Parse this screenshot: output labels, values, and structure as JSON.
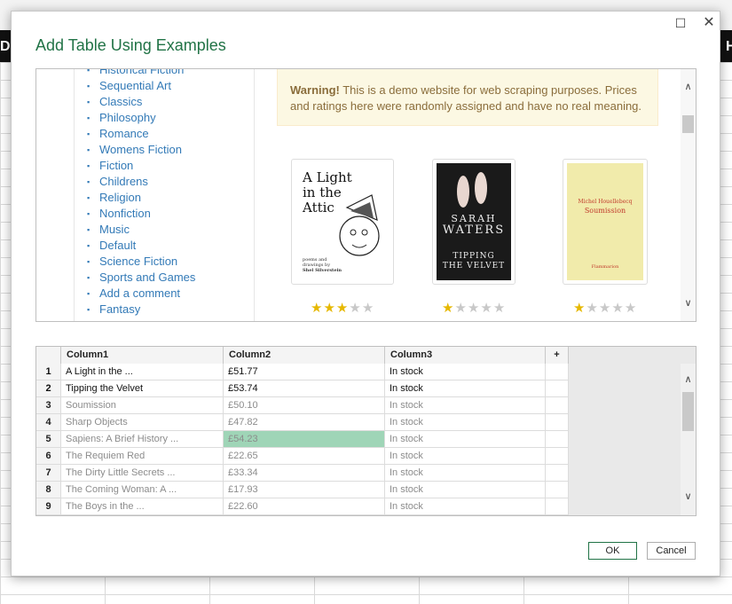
{
  "background": {
    "left_char": "D",
    "right_char": "H"
  },
  "dialog": {
    "title": "Add Table Using Examples",
    "maximize_glyph": "☐",
    "close_glyph": "✕",
    "ok_label": "OK",
    "cancel_label": "Cancel"
  },
  "preview": {
    "categories": [
      "Historical Fiction",
      "Sequential Art",
      "Classics",
      "Philosophy",
      "Romance",
      "Womens Fiction",
      "Fiction",
      "Childrens",
      "Religion",
      "Nonfiction",
      "Music",
      "Default",
      "Science Fiction",
      "Sports and Games",
      "Add a comment",
      "Fantasy"
    ],
    "warning": {
      "bold": "Warning!",
      "text": " This is a demo website for web scraping purposes. Prices and ratings here were randomly assigned and have no real meaning."
    },
    "books": [
      {
        "cover_title_lines": [
          "A Light",
          "in the",
          "Attic"
        ],
        "cover_credit_1": "poems and",
        "cover_credit_2": "drawings by",
        "cover_author": "Shel Silverstein",
        "rating": 3
      },
      {
        "cover_author": "SARAH",
        "cover_author_2": "WATERS",
        "cover_title_1": "TIPPING",
        "cover_title_2": "THE VELVET",
        "rating": 1
      },
      {
        "cover_author": "Michel Houellebecq",
        "cover_title": "Soumission",
        "cover_publisher": "Flammarion",
        "rating": 1
      }
    ],
    "star_glyph": "★",
    "scroll_up": "∧",
    "scroll_down": "∨"
  },
  "table": {
    "columns": [
      "Column1",
      "Column2",
      "Column3"
    ],
    "add_column": "+",
    "rows": [
      {
        "num": "1",
        "c1": "A Light in the ...",
        "c2": "£51.77",
        "c3": "In stock",
        "kind": "typed"
      },
      {
        "num": "2",
        "c1": "Tipping the Velvet",
        "c2": "£53.74",
        "c3": "In stock",
        "kind": "typed"
      },
      {
        "num": "3",
        "c1": "Soumission",
        "c2": "£50.10",
        "c3": "In stock",
        "kind": "suggested"
      },
      {
        "num": "4",
        "c1": "Sharp Objects",
        "c2": "£47.82",
        "c3": "In stock",
        "kind": "suggested"
      },
      {
        "num": "5",
        "c1": "Sapiens: A Brief History ...",
        "c2": "£54.23",
        "c3": "In stock",
        "kind": "suggested"
      },
      {
        "num": "6",
        "c1": "The Requiem Red",
        "c2": "£22.65",
        "c3": "In stock",
        "kind": "suggested"
      },
      {
        "num": "7",
        "c1": "The Dirty Little Secrets ...",
        "c2": "£33.34",
        "c3": "In stock",
        "kind": "suggested"
      },
      {
        "num": "8",
        "c1": "The Coming Woman: A ...",
        "c2": "£17.93",
        "c3": "In stock",
        "kind": "suggested"
      },
      {
        "num": "9",
        "c1": "The Boys in the ...",
        "c2": "£22.60",
        "c3": "In stock",
        "kind": "suggested"
      }
    ]
  },
  "colors": {
    "accent": "#217346",
    "link": "#337ab7",
    "warning_bg": "#fcf8e3",
    "selected_cell": "#9fd5b7",
    "star": "#e6b800"
  }
}
